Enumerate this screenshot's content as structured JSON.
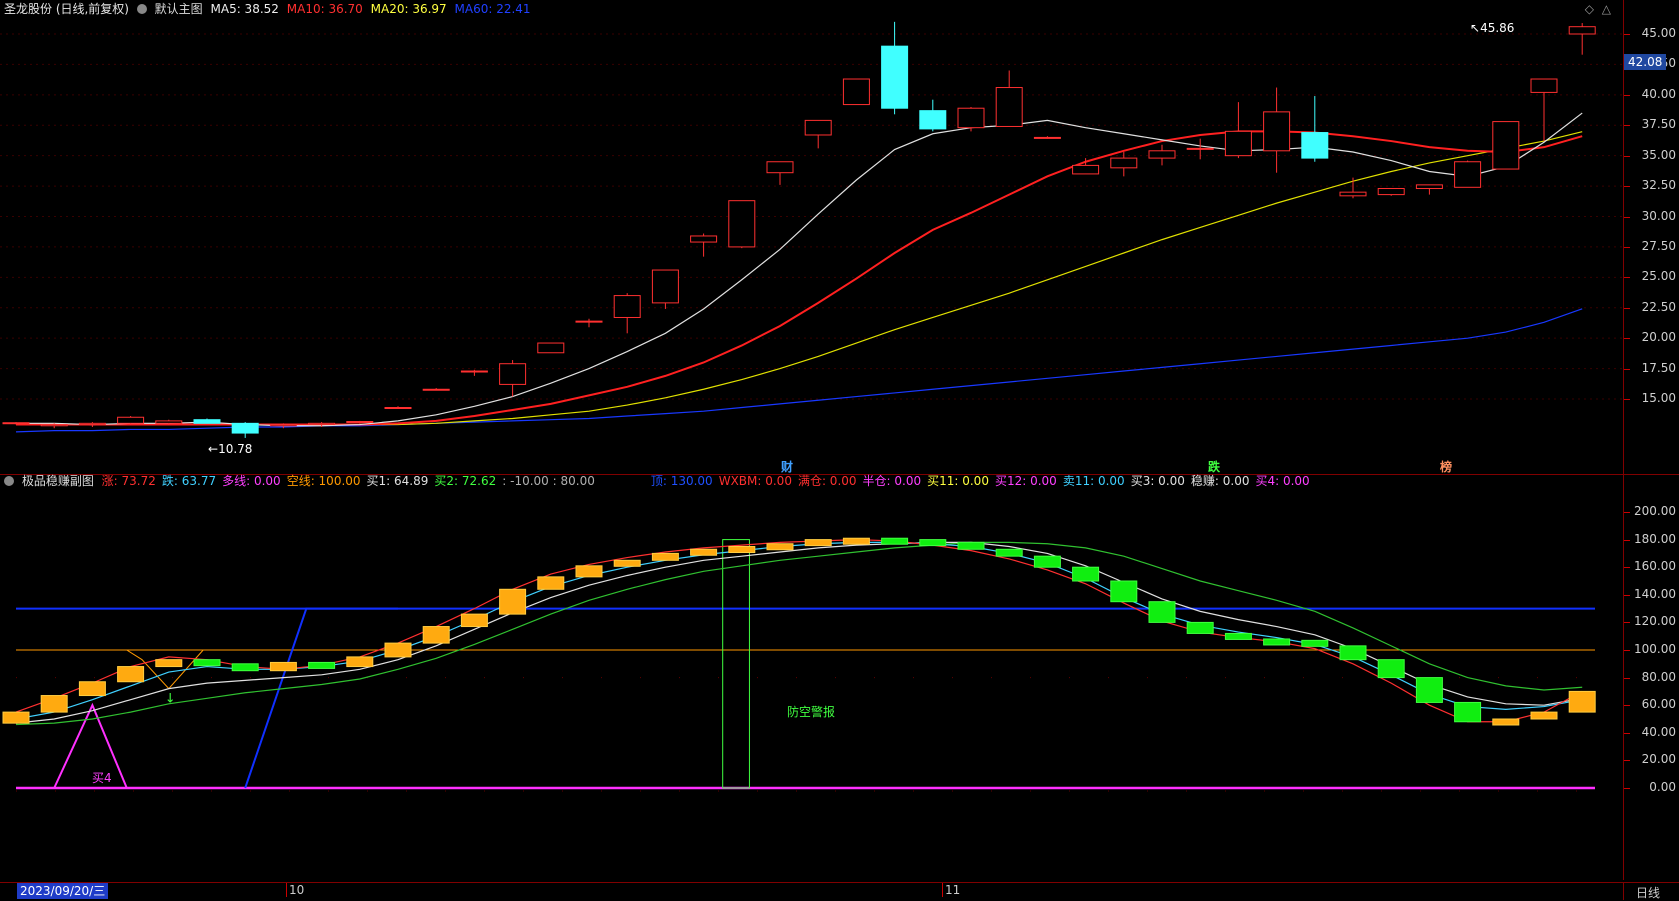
{
  "main_header": {
    "title": "圣龙股份 (日线,前复权)",
    "template": "默认主图",
    "ma5": "MA5: 38.52",
    "ma10": "MA10: 36.70",
    "ma20": "MA20: 36.97",
    "ma60": "MA60: 22.41"
  },
  "sub_header": {
    "title": "极品稳赚副图",
    "items": [
      {
        "text": "涨: 73.72",
        "color": "#ff3030"
      },
      {
        "text": "跌: 63.77",
        "color": "#40d0ff"
      },
      {
        "text": "多线: 0.00",
        "color": "#ff40ff"
      },
      {
        "text": "空线: 100.00",
        "color": "#ff9900"
      },
      {
        "text": "买1: 64.89",
        "color": "#e0e0e0"
      },
      {
        "text": "买2: 72.62",
        "color": "#40ff40"
      },
      {
        "text": ": -10.00 : 80.00",
        "color": "#b0b0b0"
      },
      {
        "text": "顶: 130.00",
        "color": "#2050ff"
      },
      {
        "text": "WXBM: 0.00",
        "color": "#ff3030"
      },
      {
        "text": "满仓: 0.00",
        "color": "#ff3030"
      },
      {
        "text": "半仓: 0.00",
        "color": "#ff40ff"
      },
      {
        "text": "买11: 0.00",
        "color": "#ffff40"
      },
      {
        "text": "买12: 0.00",
        "color": "#ff40ff"
      },
      {
        "text": "卖11: 0.00",
        "color": "#40d0ff"
      },
      {
        "text": "买3: 0.00",
        "color": "#e0e0e0"
      },
      {
        "text": "稳赚: 0.00",
        "color": "#e0e0e0"
      },
      {
        "text": "买4: 0.00",
        "color": "#ff40ff"
      }
    ]
  },
  "main_axis": [
    "45.00",
    "42.50",
    "40.00",
    "37.50",
    "35.00",
    "32.50",
    "30.00",
    "27.50",
    "25.00",
    "22.50",
    "20.00",
    "17.50",
    "15.00"
  ],
  "sub_axis": [
    "200.00",
    "180.00",
    "160.00",
    "140.00",
    "120.00",
    "100.00",
    "80.00",
    "60.00",
    "40.00",
    "20.00",
    "0.00"
  ],
  "current_price": "42.08",
  "high_label": "45.86",
  "low_label": "10.78",
  "markers": {
    "cai": "财",
    "die": "跌",
    "bang": "榜"
  },
  "alert_text": "防空警报",
  "buy4_label": "买4",
  "date_cursor": "2023/09/20/三",
  "month_labels": {
    "oct": "10",
    "nov": "11"
  },
  "period": "日线",
  "chart_data": [
    {
      "type": "candlestick",
      "title": "圣龙股份 (日线,前复权)",
      "candles": [
        {
          "o": 13.0,
          "h": 13.1,
          "l": 12.9,
          "c": 13.05
        },
        {
          "o": 12.8,
          "h": 13.0,
          "l": 12.6,
          "c": 12.9
        },
        {
          "o": 12.9,
          "h": 13.1,
          "l": 12.7,
          "c": 13.0
        },
        {
          "o": 13.0,
          "h": 13.6,
          "l": 12.9,
          "c": 13.5
        },
        {
          "o": 13.0,
          "h": 13.3,
          "l": 12.9,
          "c": 13.2
        },
        {
          "o": 13.3,
          "h": 13.4,
          "l": 13.0,
          "c": 13.0
        },
        {
          "o": 13.0,
          "h": 13.1,
          "l": 11.8,
          "c": 12.2
        },
        {
          "o": 12.8,
          "h": 13.0,
          "l": 12.6,
          "c": 12.9
        },
        {
          "o": 12.9,
          "h": 13.1,
          "l": 12.7,
          "c": 13.0
        },
        {
          "o": 13.1,
          "h": 13.2,
          "l": 13.0,
          "c": 13.15
        },
        {
          "o": 14.3,
          "h": 14.4,
          "l": 14.2,
          "c": 14.3
        },
        {
          "o": 15.8,
          "h": 15.9,
          "l": 15.7,
          "c": 15.8
        },
        {
          "o": 17.3,
          "h": 17.4,
          "l": 16.9,
          "c": 17.3
        },
        {
          "o": 16.2,
          "h": 18.2,
          "l": 15.2,
          "c": 17.9
        },
        {
          "o": 18.8,
          "h": 19.6,
          "l": 18.8,
          "c": 19.6
        },
        {
          "o": 21.4,
          "h": 21.6,
          "l": 20.9,
          "c": 21.4
        },
        {
          "o": 21.7,
          "h": 23.7,
          "l": 20.4,
          "c": 23.5
        },
        {
          "o": 22.9,
          "h": 25.6,
          "l": 22.4,
          "c": 25.6
        },
        {
          "o": 27.9,
          "h": 28.6,
          "l": 26.7,
          "c": 28.4
        },
        {
          "o": 27.5,
          "h": 31.3,
          "l": 27.4,
          "c": 31.3
        },
        {
          "o": 33.6,
          "h": 34.5,
          "l": 32.6,
          "c": 34.5
        },
        {
          "o": 36.7,
          "h": 37.9,
          "l": 35.6,
          "c": 37.9
        },
        {
          "o": 39.2,
          "h": 41.3,
          "l": 39.2,
          "c": 41.3
        },
        {
          "o": 44.0,
          "h": 46.0,
          "l": 38.4,
          "c": 38.9
        },
        {
          "o": 38.7,
          "h": 39.6,
          "l": 37.0,
          "c": 37.2
        },
        {
          "o": 37.3,
          "h": 39.0,
          "l": 37.0,
          "c": 38.9
        },
        {
          "o": 37.4,
          "h": 42.0,
          "l": 37.4,
          "c": 40.6
        },
        {
          "o": 36.5,
          "h": 36.6,
          "l": 36.4,
          "c": 36.5
        },
        {
          "o": 33.5,
          "h": 34.8,
          "l": 33.5,
          "c": 34.2
        },
        {
          "o": 34.0,
          "h": 35.3,
          "l": 33.3,
          "c": 34.8
        },
        {
          "o": 34.8,
          "h": 35.9,
          "l": 34.2,
          "c": 35.4
        },
        {
          "o": 35.6,
          "h": 36.4,
          "l": 34.7,
          "c": 35.6
        },
        {
          "o": 35.0,
          "h": 39.4,
          "l": 34.8,
          "c": 37.0
        },
        {
          "o": 35.4,
          "h": 40.6,
          "l": 33.6,
          "c": 38.6
        },
        {
          "o": 36.9,
          "h": 39.9,
          "l": 34.5,
          "c": 34.8
        },
        {
          "o": 31.7,
          "h": 33.2,
          "l": 31.5,
          "c": 32.0
        },
        {
          "o": 31.8,
          "h": 32.3,
          "l": 31.7,
          "c": 32.3
        },
        {
          "o": 32.3,
          "h": 32.6,
          "l": 31.8,
          "c": 32.6
        },
        {
          "o": 32.4,
          "h": 34.6,
          "l": 32.4,
          "c": 34.5
        },
        {
          "o": 33.9,
          "h": 37.8,
          "l": 33.9,
          "c": 37.8
        },
        {
          "o": 40.2,
          "h": 41.3,
          "l": 36.2,
          "c": 41.3
        },
        {
          "o": 45.0,
          "h": 45.9,
          "l": 43.3,
          "c": 45.6
        }
      ],
      "ma5": [
        13.0,
        13.0,
        12.9,
        13.0,
        13.0,
        13.1,
        12.9,
        12.8,
        12.8,
        12.9,
        13.2,
        13.7,
        14.4,
        15.2,
        16.3,
        17.5,
        18.9,
        20.4,
        22.4,
        24.8,
        27.3,
        30.2,
        33.0,
        35.5,
        36.8,
        37.3,
        37.5,
        37.9,
        37.3,
        36.8,
        36.3,
        35.8,
        35.4,
        35.5,
        35.7,
        35.3,
        34.6,
        33.7,
        33.3,
        34.1,
        36.1,
        38.5
      ],
      "ma10": [
        12.9,
        12.9,
        12.9,
        12.9,
        12.9,
        12.9,
        12.9,
        12.9,
        12.9,
        12.9,
        13.0,
        13.2,
        13.6,
        14.1,
        14.6,
        15.3,
        16.0,
        16.9,
        18.0,
        19.4,
        21.0,
        22.9,
        24.9,
        27.0,
        28.9,
        30.3,
        31.8,
        33.3,
        34.5,
        35.4,
        36.2,
        36.7,
        37.0,
        37.0,
        36.9,
        36.6,
        36.2,
        35.7,
        35.4,
        35.3,
        35.7,
        36.6
      ],
      "ma20": [
        12.9,
        12.9,
        12.9,
        12.9,
        12.9,
        12.9,
        12.9,
        12.9,
        12.9,
        12.9,
        12.9,
        13.0,
        13.2,
        13.4,
        13.7,
        14.0,
        14.5,
        15.1,
        15.8,
        16.6,
        17.5,
        18.5,
        19.6,
        20.7,
        21.7,
        22.7,
        23.7,
        24.8,
        25.9,
        27.0,
        28.1,
        29.1,
        30.1,
        31.1,
        32.0,
        32.9,
        33.7,
        34.4,
        35.0,
        35.6,
        36.2,
        36.97
      ],
      "ma60": [
        12.3,
        12.4,
        12.4,
        12.5,
        12.5,
        12.6,
        12.7,
        12.7,
        12.8,
        12.8,
        12.9,
        13.0,
        13.1,
        13.2,
        13.3,
        13.4,
        13.6,
        13.8,
        14.0,
        14.3,
        14.6,
        14.9,
        15.2,
        15.5,
        15.8,
        16.1,
        16.4,
        16.7,
        17.0,
        17.3,
        17.6,
        17.9,
        18.2,
        18.5,
        18.8,
        19.1,
        19.4,
        19.7,
        20.0,
        20.5,
        21.3,
        22.41
      ]
    },
    {
      "type": "indicator",
      "title": "极品稳赚副图",
      "bars": [
        55,
        67,
        77,
        88,
        93,
        90,
        85,
        91,
        88,
        95,
        105,
        117,
        126,
        144,
        153,
        161,
        165,
        170,
        173,
        175,
        177,
        180,
        181,
        180,
        178,
        173,
        168,
        160,
        150,
        135,
        120,
        112,
        108,
        107,
        103,
        93,
        80,
        62,
        48,
        50,
        55,
        70
      ],
      "rise": [
        55,
        65,
        76,
        88,
        95,
        93,
        88,
        86,
        89,
        95,
        105,
        117,
        130,
        144,
        155,
        162,
        167,
        171,
        174,
        176,
        178,
        179,
        180,
        179,
        176,
        172,
        166,
        158,
        148,
        134,
        121,
        113,
        109,
        106,
        101,
        90,
        76,
        60,
        48,
        48,
        55,
        70
      ],
      "fall": [
        50,
        55,
        64,
        74,
        84,
        88,
        86,
        86,
        88,
        92,
        100,
        110,
        122,
        135,
        146,
        154,
        160,
        165,
        169,
        172,
        175,
        177,
        178,
        178,
        177,
        175,
        170,
        163,
        152,
        138,
        126,
        118,
        113,
        109,
        104,
        95,
        82,
        68,
        59,
        57,
        59,
        64
      ],
      "buy1": [
        47,
        50,
        56,
        64,
        72,
        76,
        78,
        80,
        82,
        86,
        93,
        103,
        115,
        127,
        138,
        147,
        154,
        160,
        165,
        168,
        171,
        174,
        176,
        177,
        178,
        178,
        175,
        170,
        161,
        149,
        137,
        128,
        122,
        117,
        111,
        101,
        88,
        75,
        66,
        61,
        60,
        65
      ],
      "buy2": [
        46,
        47,
        50,
        55,
        61,
        65,
        69,
        72,
        75,
        79,
        86,
        94,
        104,
        115,
        126,
        136,
        144,
        151,
        157,
        161,
        165,
        168,
        171,
        174,
        176,
        178,
        178,
        177,
        174,
        168,
        159,
        150,
        143,
        136,
        128,
        116,
        103,
        90,
        80,
        74,
        71,
        73
      ],
      "top_line": 130,
      "kong_line": 100,
      "zero_line": 0
    }
  ]
}
